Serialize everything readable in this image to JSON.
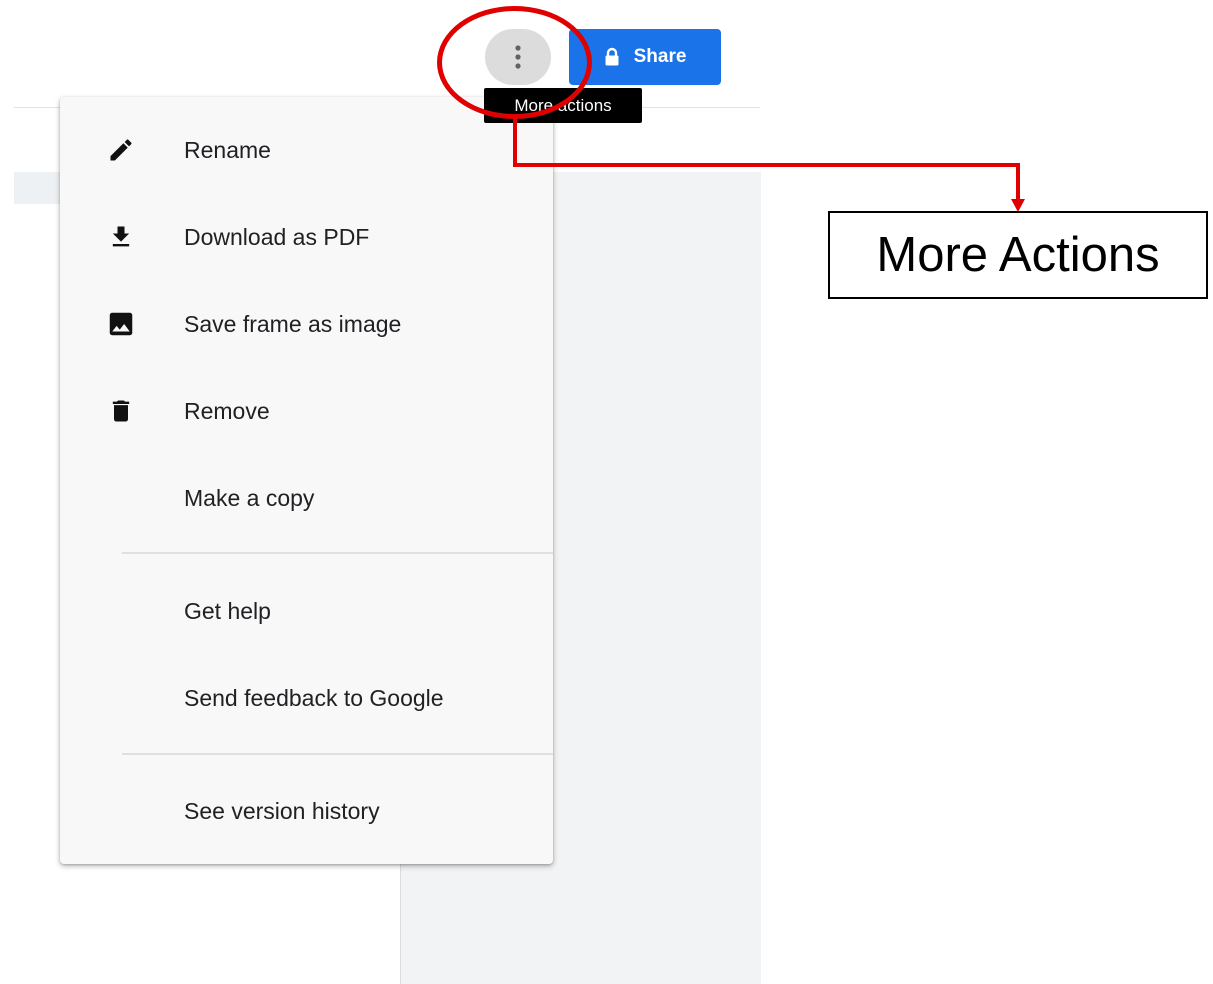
{
  "header": {
    "more_button": {
      "icon": "more-vert-icon"
    },
    "share_button": {
      "label": "Share",
      "icon": "lock-icon"
    },
    "tooltip": "More actions"
  },
  "menu": {
    "items": [
      {
        "label": "Rename",
        "icon": "pencil-icon"
      },
      {
        "label": "Download as PDF",
        "icon": "download-icon"
      },
      {
        "label": "Save frame as image",
        "icon": "image-icon"
      },
      {
        "label": "Remove",
        "icon": "trash-icon"
      },
      {
        "label": "Make a copy",
        "icon": ""
      },
      {
        "label": "Get help",
        "icon": ""
      },
      {
        "label": "Send feedback to Google",
        "icon": ""
      },
      {
        "label": "See version history",
        "icon": ""
      }
    ]
  },
  "annotation": {
    "callout_label": "More Actions",
    "highlight_color": "#e00000"
  },
  "colors": {
    "accent": "#1a73e8",
    "menu_background": "#f8f8f8",
    "text": "#202124"
  }
}
